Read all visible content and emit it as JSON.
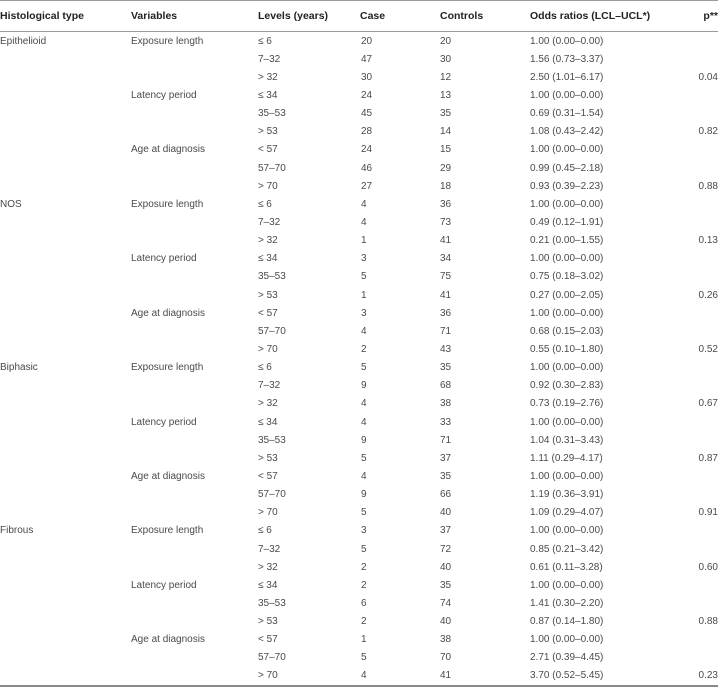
{
  "table": {
    "headers": [
      "Histological type",
      "Variables",
      "Levels (years)",
      "Case",
      "Controls",
      "Odds ratios (LCL–UCL*)",
      "p**"
    ],
    "rows": [
      {
        "type": "Epithelioid",
        "variable": "Exposure length",
        "level": "≤ 6",
        "case": "20",
        "controls": "20",
        "or": "1.00 (0.00–0.00)",
        "p": ""
      },
      {
        "type": "",
        "variable": "",
        "level": "7–32",
        "case": "47",
        "controls": "30",
        "or": "1.56 (0.73–3.37)",
        "p": ""
      },
      {
        "type": "",
        "variable": "",
        "level": "> 32",
        "case": "30",
        "controls": "12",
        "or": "2.50 (1.01–6.17)",
        "p": "0.04"
      },
      {
        "type": "",
        "variable": "Latency period",
        "level": "≤ 34",
        "case": "24",
        "controls": "13",
        "or": "1.00 (0.00–0.00)",
        "p": ""
      },
      {
        "type": "",
        "variable": "",
        "level": "35–53",
        "case": "45",
        "controls": "35",
        "or": "0.69 (0.31–1.54)",
        "p": ""
      },
      {
        "type": "",
        "variable": "",
        "level": "> 53",
        "case": "28",
        "controls": "14",
        "or": "1.08 (0.43–2.42)",
        "p": "0.82"
      },
      {
        "type": "",
        "variable": "Age at diagnosis",
        "level": "< 57",
        "case": "24",
        "controls": "15",
        "or": "1.00 (0.00–0.00)",
        "p": ""
      },
      {
        "type": "",
        "variable": "",
        "level": "57–70",
        "case": "46",
        "controls": "29",
        "or": "0.99 (0.45–2.18)",
        "p": ""
      },
      {
        "type": "",
        "variable": "",
        "level": "> 70",
        "case": "27",
        "controls": "18",
        "or": "0.93 (0.39–2.23)",
        "p": "0.88"
      },
      {
        "type": "NOS",
        "variable": "Exposure length",
        "level": "≤ 6",
        "case": "4",
        "controls": "36",
        "or": "1.00 (0.00–0.00)",
        "p": ""
      },
      {
        "type": "",
        "variable": "",
        "level": "7–32",
        "case": "4",
        "controls": "73",
        "or": "0.49 (0.12–1.91)",
        "p": ""
      },
      {
        "type": "",
        "variable": "",
        "level": "> 32",
        "case": "1",
        "controls": "41",
        "or": "0.21 (0.00–1.55)",
        "p": "0.13"
      },
      {
        "type": "",
        "variable": "Latency period",
        "level": "≤ 34",
        "case": "3",
        "controls": "34",
        "or": "1.00 (0.00–0.00)",
        "p": ""
      },
      {
        "type": "",
        "variable": "",
        "level": "35–53",
        "case": "5",
        "controls": "75",
        "or": "0.75 (0.18–3.02)",
        "p": ""
      },
      {
        "type": "",
        "variable": "",
        "level": "> 53",
        "case": "1",
        "controls": "41",
        "or": "0.27 (0.00–2.05)",
        "p": "0.26"
      },
      {
        "type": "",
        "variable": "Age at diagnosis",
        "level": "< 57",
        "case": "3",
        "controls": "36",
        "or": "1.00 (0.00–0.00)",
        "p": ""
      },
      {
        "type": "",
        "variable": "",
        "level": "57–70",
        "case": "4",
        "controls": "71",
        "or": "0.68 (0.15–2.03)",
        "p": ""
      },
      {
        "type": "",
        "variable": "",
        "level": "> 70",
        "case": "2",
        "controls": "43",
        "or": "0.55 (0.10–1.80)",
        "p": "0.52"
      },
      {
        "type": "Biphasic",
        "variable": "Exposure length",
        "level": "≤ 6",
        "case": "5",
        "controls": "35",
        "or": "1.00 (0.00–0.00)",
        "p": ""
      },
      {
        "type": "",
        "variable": "",
        "level": "7–32",
        "case": "9",
        "controls": "68",
        "or": "0.92 (0.30–2.83)",
        "p": ""
      },
      {
        "type": "",
        "variable": "",
        "level": "> 32",
        "case": "4",
        "controls": "38",
        "or": "0.73 (0.19–2.76)",
        "p": "0.67"
      },
      {
        "type": "",
        "variable": "Latency period",
        "level": "≤ 34",
        "case": "4",
        "controls": "33",
        "or": "1.00 (0.00–0.00)",
        "p": ""
      },
      {
        "type": "",
        "variable": "",
        "level": "35–53",
        "case": "9",
        "controls": "71",
        "or": "1.04 (0.31–3.43)",
        "p": ""
      },
      {
        "type": "",
        "variable": "",
        "level": "> 53",
        "case": "5",
        "controls": "37",
        "or": "1.11 (0.29–4.17)",
        "p": "0.87"
      },
      {
        "type": "",
        "variable": "Age at diagnosis",
        "level": "< 57",
        "case": "4",
        "controls": "35",
        "or": "1.00 (0.00–0.00)",
        "p": ""
      },
      {
        "type": "",
        "variable": "",
        "level": "57–70",
        "case": "9",
        "controls": "66",
        "or": "1.19 (0.36–3.91)",
        "p": ""
      },
      {
        "type": "",
        "variable": "",
        "level": "> 70",
        "case": "5",
        "controls": "40",
        "or": "1.09 (0.29–4.07)",
        "p": "0.91"
      },
      {
        "type": "Fibrous",
        "variable": "Exposure length",
        "level": "≤ 6",
        "case": "3",
        "controls": "37",
        "or": "1.00 (0.00–0.00)",
        "p": ""
      },
      {
        "type": "",
        "variable": "",
        "level": "7–32",
        "case": "5",
        "controls": "72",
        "or": "0.85 (0.21–3.42)",
        "p": ""
      },
      {
        "type": "",
        "variable": "",
        "level": "> 32",
        "case": "2",
        "controls": "40",
        "or": "0.61 (0.11–3.28)",
        "p": "0.60"
      },
      {
        "type": "",
        "variable": "Latency period",
        "level": "≤ 34",
        "case": "2",
        "controls": "35",
        "or": "1.00 (0.00–0.00)",
        "p": ""
      },
      {
        "type": "",
        "variable": "",
        "level": "35–53",
        "case": "6",
        "controls": "74",
        "or": "1.41 (0.30–2.20)",
        "p": ""
      },
      {
        "type": "",
        "variable": "",
        "level": "> 53",
        "case": "2",
        "controls": "40",
        "or": "0.87 (0.14–1.80)",
        "p": "0.88"
      },
      {
        "type": "",
        "variable": "Age at diagnosis",
        "level": "< 57",
        "case": "1",
        "controls": "38",
        "or": "1.00 (0.00–0.00)",
        "p": ""
      },
      {
        "type": "",
        "variable": "",
        "level": "57–70",
        "case": "5",
        "controls": "70",
        "or": "2.71 (0.39–4.45)",
        "p": ""
      },
      {
        "type": "",
        "variable": "",
        "level": "> 70",
        "case": "4",
        "controls": "41",
        "or": "3.70 (0.52–5.45)",
        "p": "0.23"
      }
    ]
  }
}
